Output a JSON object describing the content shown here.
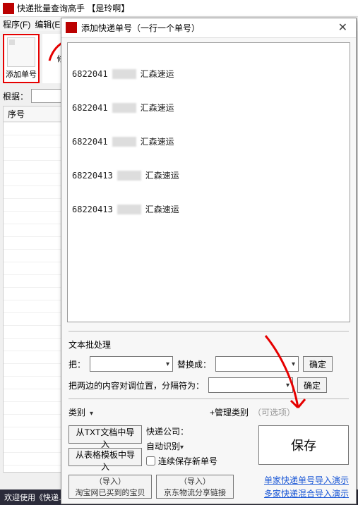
{
  "main": {
    "title": "快递批量查询高手  【是玲啊】",
    "menu": {
      "file": "程序(F)",
      "edit": "编辑(E"
    },
    "toolbar": {
      "add_label": "添加单号",
      "mod_label": "修"
    },
    "filter": {
      "label": "根据："
    },
    "grid": {
      "col0": "序号"
    },
    "status": "欢迎使用《快递…"
  },
  "dialog": {
    "title": "添加快递单号（一行一个单号）",
    "tracking": [
      {
        "no_prefix": "6822041",
        "company": "汇森速运"
      },
      {
        "no_prefix": "6822041",
        "company": "汇森速运"
      },
      {
        "no_prefix": "6822041",
        "company": "汇森速运"
      },
      {
        "no_prefix": "68220413",
        "company": "汇森速运"
      },
      {
        "no_prefix": "68220413",
        "company": "汇森速运"
      }
    ],
    "batch": {
      "section_label": "文本批处理",
      "put_label": "把：",
      "replace_label": "替换成：",
      "ok_label": "确定",
      "swap_label": "把两边的内容对调位置，分隔符为：",
      "swap_ok_label": "确定"
    },
    "category": {
      "label": "类别",
      "manage": "+管理类别",
      "optional": "（可选项）"
    },
    "import": {
      "from_txt": "从TXT文档中导入",
      "from_template": "从表格模板中导入",
      "company_label": "快递公司：",
      "auto_detect": "自动识别",
      "continuous_save": "连续保存新单号"
    },
    "save_label": "保存",
    "bottom": {
      "hint1_top": "（导入）",
      "hint1_bottom": "淘宝网已买到的宝贝",
      "hint2_top": "（导入）",
      "hint2_bottom": "京东物流分享链接",
      "link1": "单家快递单号导入演示",
      "link2": "多家快递混合导入演示"
    }
  }
}
